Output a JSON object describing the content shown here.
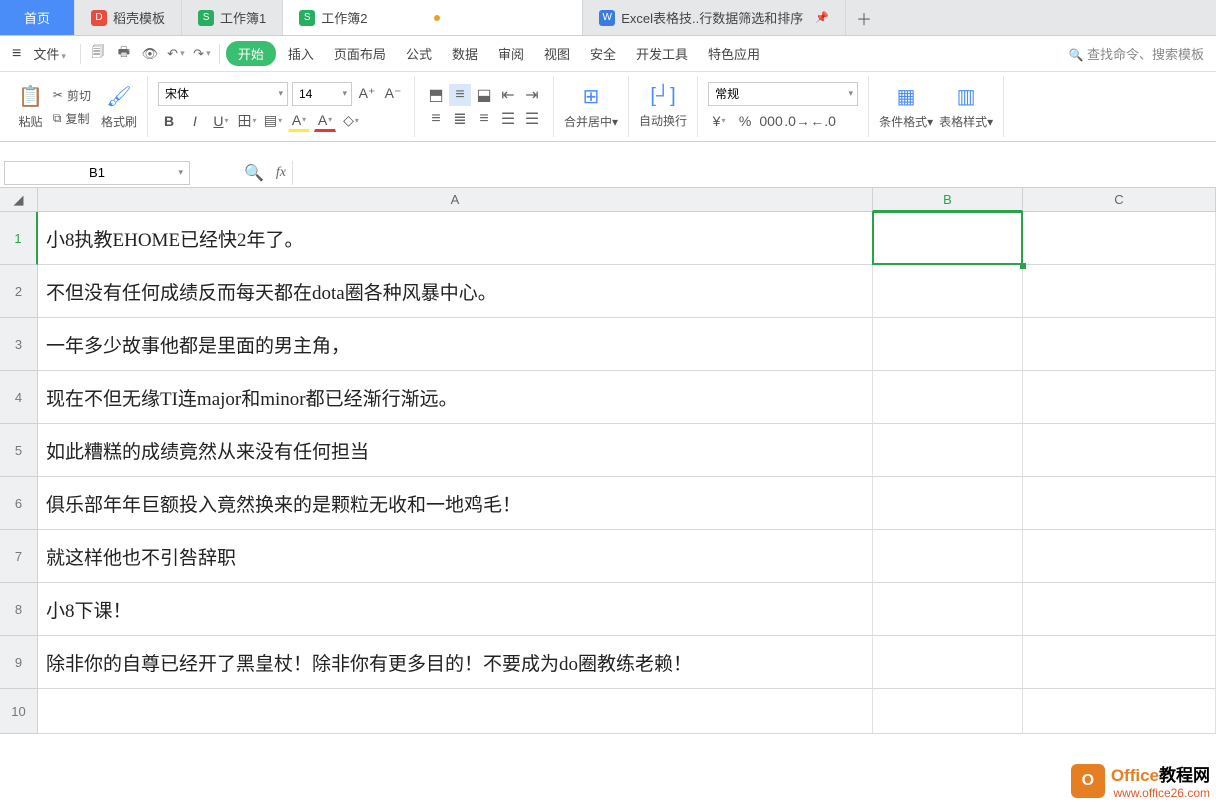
{
  "tabs": {
    "home": "首页",
    "t1": "稻壳模板",
    "t2": "工作簿1",
    "t3": "工作簿2",
    "t4": "Excel表格技..行数据筛选和排序"
  },
  "menu": {
    "file": "文件",
    "start": "开始",
    "insert": "插入",
    "layout": "页面布局",
    "formula": "公式",
    "data": "数据",
    "review": "审阅",
    "view": "视图",
    "security": "安全",
    "dev": "开发工具",
    "special": "特色应用",
    "search": "查找命令、搜索模板"
  },
  "toolbar": {
    "paste": "粘贴",
    "cut": "剪切",
    "copy": "复制",
    "format_painter": "格式刷",
    "font_name": "宋体",
    "font_size": "14",
    "merge": "合并居中",
    "wrap": "自动换行",
    "general": "常规",
    "cond_format": "条件格式",
    "table_style": "表格样式"
  },
  "namebox": "B1",
  "columns": {
    "A": "A",
    "B": "B",
    "C": "C"
  },
  "rows": [
    "1",
    "2",
    "3",
    "4",
    "5",
    "6",
    "7",
    "8",
    "9",
    "10"
  ],
  "cells": {
    "A1": "小8执教EHOME已经快2年了。",
    "A2": "不但没有任何成绩反而每天都在dota圈各种风暴中心。",
    "A3": "一年多少故事他都是里面的男主角，",
    "A4": "现在不但无缘TI连major和minor都已经渐行渐远。",
    "A5": "如此糟糕的成绩竟然从来没有任何担当",
    "A6": "俱乐部年年巨额投入竟然换来的是颗粒无收和一地鸡毛！",
    "A7": "就这样他也不引咎辞职",
    "A8": "小8下课！",
    "A9": "除非你的自尊已经开了黑皇杖！除非你有更多目的！不要成为do圈教练老赖！"
  },
  "watermark": {
    "brand": "Office",
    "suffix": "教程网",
    "url": "www.office26.com"
  }
}
